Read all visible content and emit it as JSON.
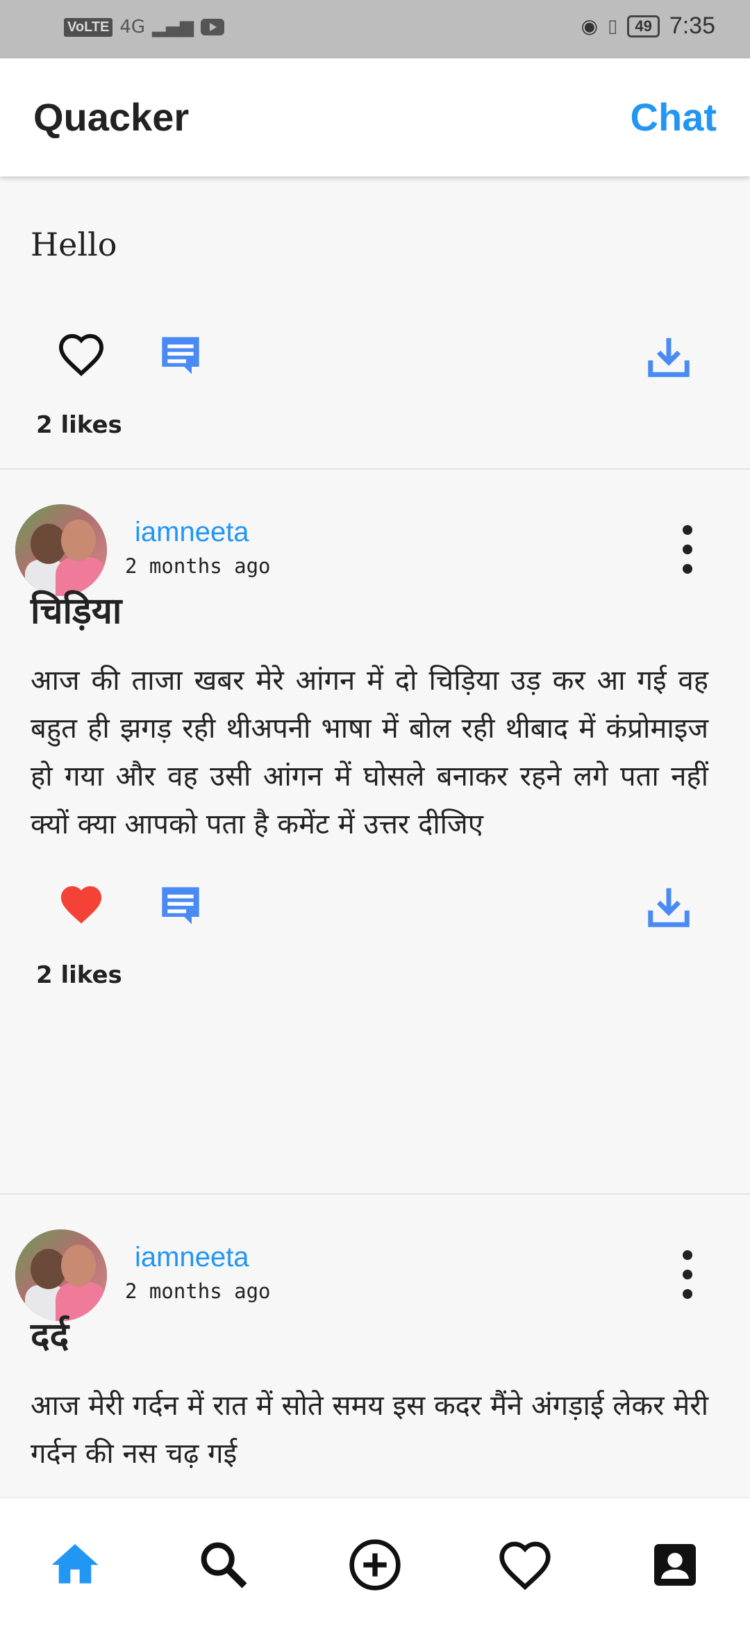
{
  "status_bar": {
    "volte": "VoLTE",
    "network": "4G",
    "battery": "49",
    "time": "7:35"
  },
  "app_bar": {
    "title": "Quacker",
    "chat": "Chat"
  },
  "first_post": {
    "body": "Hello",
    "likes": "2 likes"
  },
  "posts": [
    {
      "username": "iamneeta",
      "time": "2 months ago",
      "title": "चिड़िया",
      "body": "आज की ताजा खबर मेरे आंगन में दो चिड़िया उड़ कर आ गई वह बहुत ही झगड़ रही थीअपनी भाषा में बोल रही थीबाद में कंप्रोमाइज हो गया और वह उसी आंगन में घोसले बनाकर रहने लगे पता नहीं क्यों क्या आपको पता है कमेंट में उत्तर दीजिए",
      "likes": "2 likes",
      "liked": true
    },
    {
      "username": "iamneeta",
      "time": "2 months ago",
      "title": "दर्द",
      "body": "आज मेरी गर्दन में रात में सोते समय इस कदर मैंने अंगड़ाई लेकर मेरी गर्दन की नस चढ़ गई"
    }
  ],
  "colors": {
    "accent": "#2196f3",
    "liked": "#f44336",
    "comment": "#4a8af4"
  },
  "bottom_nav": [
    "home-icon",
    "search-icon",
    "add-circle-icon",
    "heart-icon",
    "account-box-icon"
  ]
}
